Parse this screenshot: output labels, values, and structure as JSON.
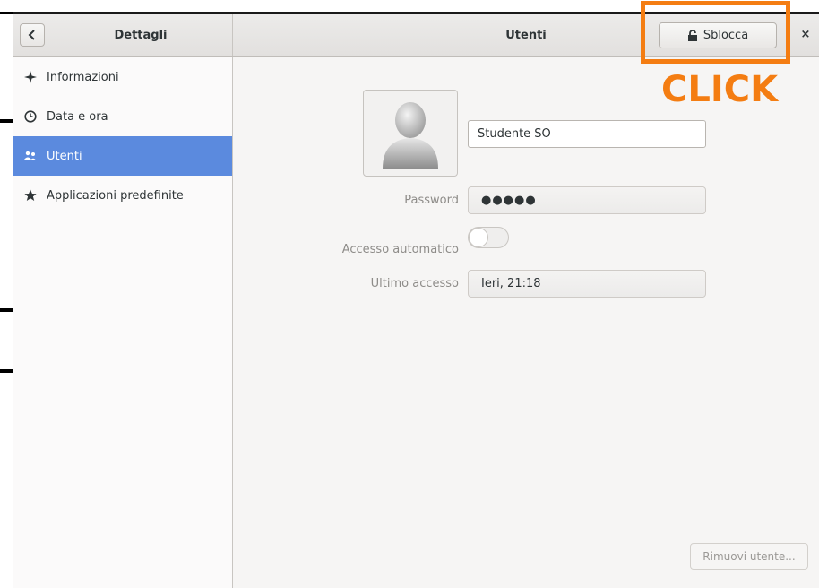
{
  "header": {
    "sidebar_title": "Dettagli",
    "main_title": "Utenti",
    "unlock_label": "Sblocca",
    "close_label": "×"
  },
  "sidebar": {
    "items": [
      {
        "label": "Informazioni",
        "icon": "sparkle-icon",
        "active": false
      },
      {
        "label": "Data e ora",
        "icon": "clock-icon",
        "active": false
      },
      {
        "label": "Utenti",
        "icon": "users-icon",
        "active": true
      },
      {
        "label": "Applicazioni predefinite",
        "icon": "star-icon",
        "active": false
      }
    ]
  },
  "user": {
    "name": "Studente SO",
    "password_label": "Password",
    "password_value": "●●●●●",
    "autologin_label": "Accesso automatico",
    "autologin_on": false,
    "last_login_label": "Ultimo accesso",
    "last_login_value": "Ieri, 21:18",
    "remove_label": "Rimuovi utente..."
  },
  "annotation": {
    "text": "CLICK",
    "color": "#f47d12"
  },
  "colors": {
    "selection": "#5b8ade",
    "window_bg": "#f6f5f4"
  }
}
